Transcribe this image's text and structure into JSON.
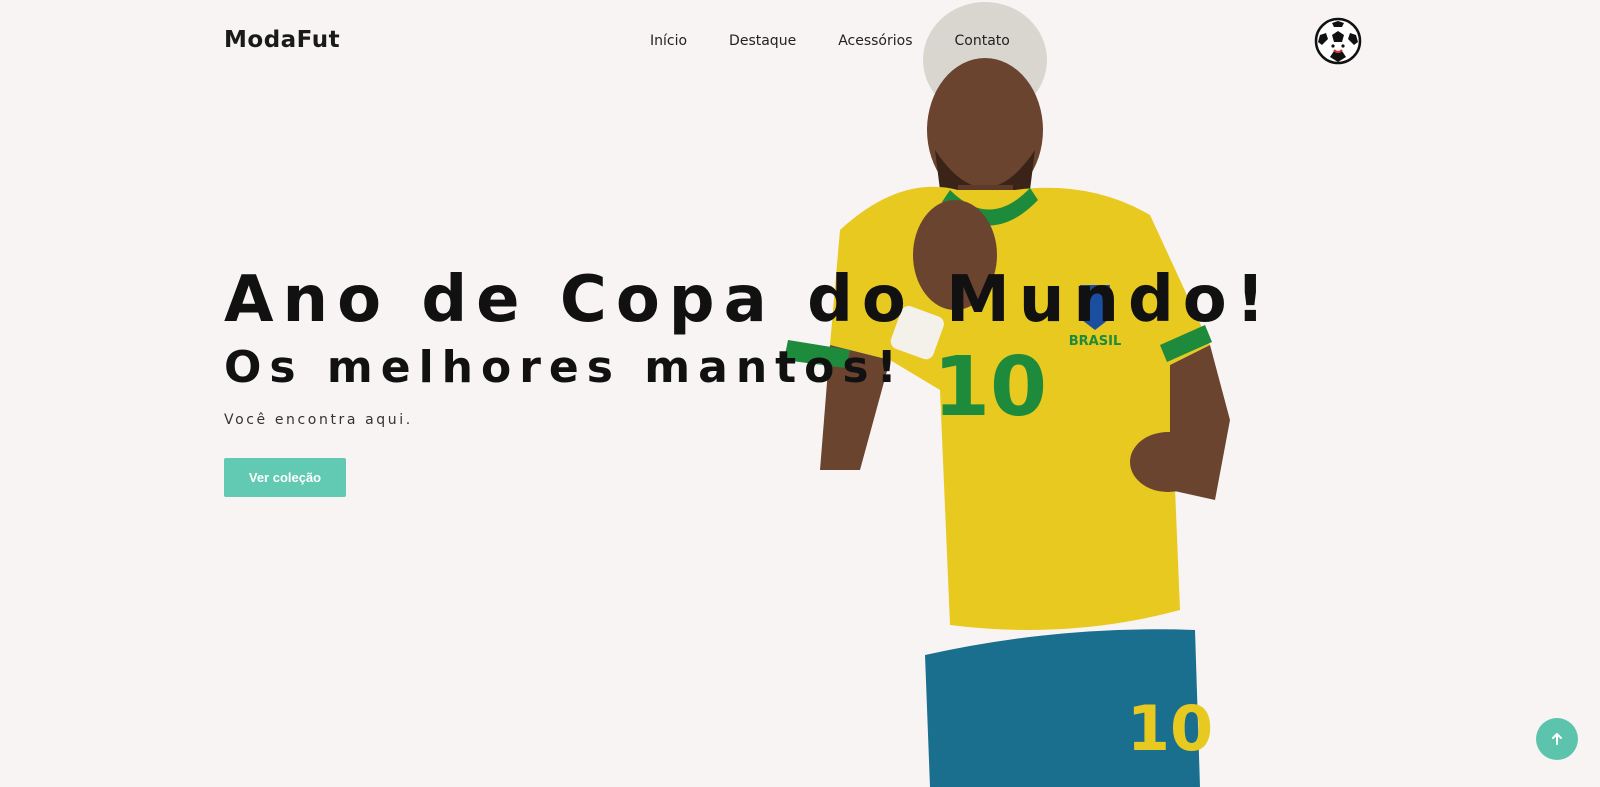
{
  "header": {
    "logo": "ModaFut",
    "nav": [
      "Início",
      "Destaque",
      "Acessórios",
      "Contato"
    ],
    "logo_icon": "soccer-ball-icon"
  },
  "hero": {
    "title": "Ano de Copa do Mundo!",
    "subtitle": "Os melhores mantos!",
    "description": "Você encontra aqui.",
    "cta_label": "Ver coleção",
    "jersey_text": "BRASIL",
    "jersey_number": "10"
  },
  "back_to_top": {
    "icon": "arrow-up-icon"
  },
  "colors": {
    "background": "#f9f4f4",
    "accent": "#62c9b3",
    "jersey_yellow": "#e8c91f",
    "jersey_green": "#1e8a3b",
    "shorts_blue": "#1a6f8f"
  }
}
